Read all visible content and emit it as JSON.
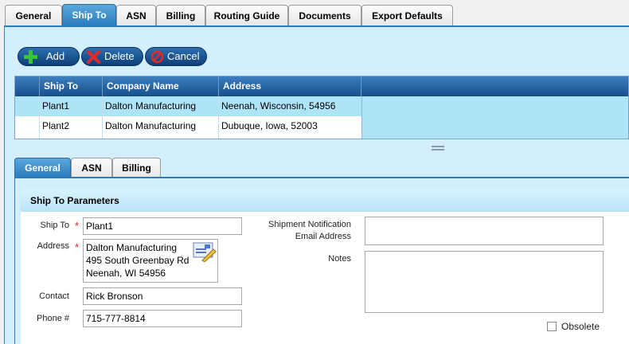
{
  "top_tabs": [
    {
      "label": "General"
    },
    {
      "label": "Ship To"
    },
    {
      "label": "ASN"
    },
    {
      "label": "Billing"
    },
    {
      "label": "Routing Guide"
    },
    {
      "label": "Documents"
    },
    {
      "label": "Export Defaults"
    }
  ],
  "active_top_tab": "Ship To",
  "toolbar": {
    "add_label": "Add",
    "delete_label": "Delete",
    "cancel_label": "Cancel"
  },
  "grid": {
    "columns": [
      "Ship To",
      "Company Name",
      "Address"
    ],
    "rows": [
      {
        "ship_to": "Plant1",
        "company": "Dalton Manufacturing",
        "address": "Neenah, Wisconsin, 54956"
      },
      {
        "ship_to": "Plant2",
        "company": "Dalton Manufacturing",
        "address": "Dubuque, Iowa, 52003"
      }
    ]
  },
  "sub_tabs": [
    {
      "label": "General"
    },
    {
      "label": "ASN"
    },
    {
      "label": "Billing"
    }
  ],
  "params": {
    "header": "Ship To Parameters",
    "ship_to_label": "Ship To",
    "ship_to_value": "Plant1",
    "address_label": "Address",
    "address_lines": [
      "Dalton Manufacturing",
      "495 South Greenbay Rd",
      "Neenah, WI 54956"
    ],
    "contact_label": "Contact",
    "contact_value": "Rick Bronson",
    "phone_label": "Phone #",
    "phone_value": "715-777-8814",
    "notification_label_1": "Shipment Notification",
    "notification_label_2": "Email Address",
    "notes_label": "Notes",
    "obsolete_label": "Obsolete",
    "required_mark": "*"
  },
  "colors": {
    "accent": "#2a7bbf",
    "panel": "#d3eefc",
    "required": "#dd2222"
  }
}
